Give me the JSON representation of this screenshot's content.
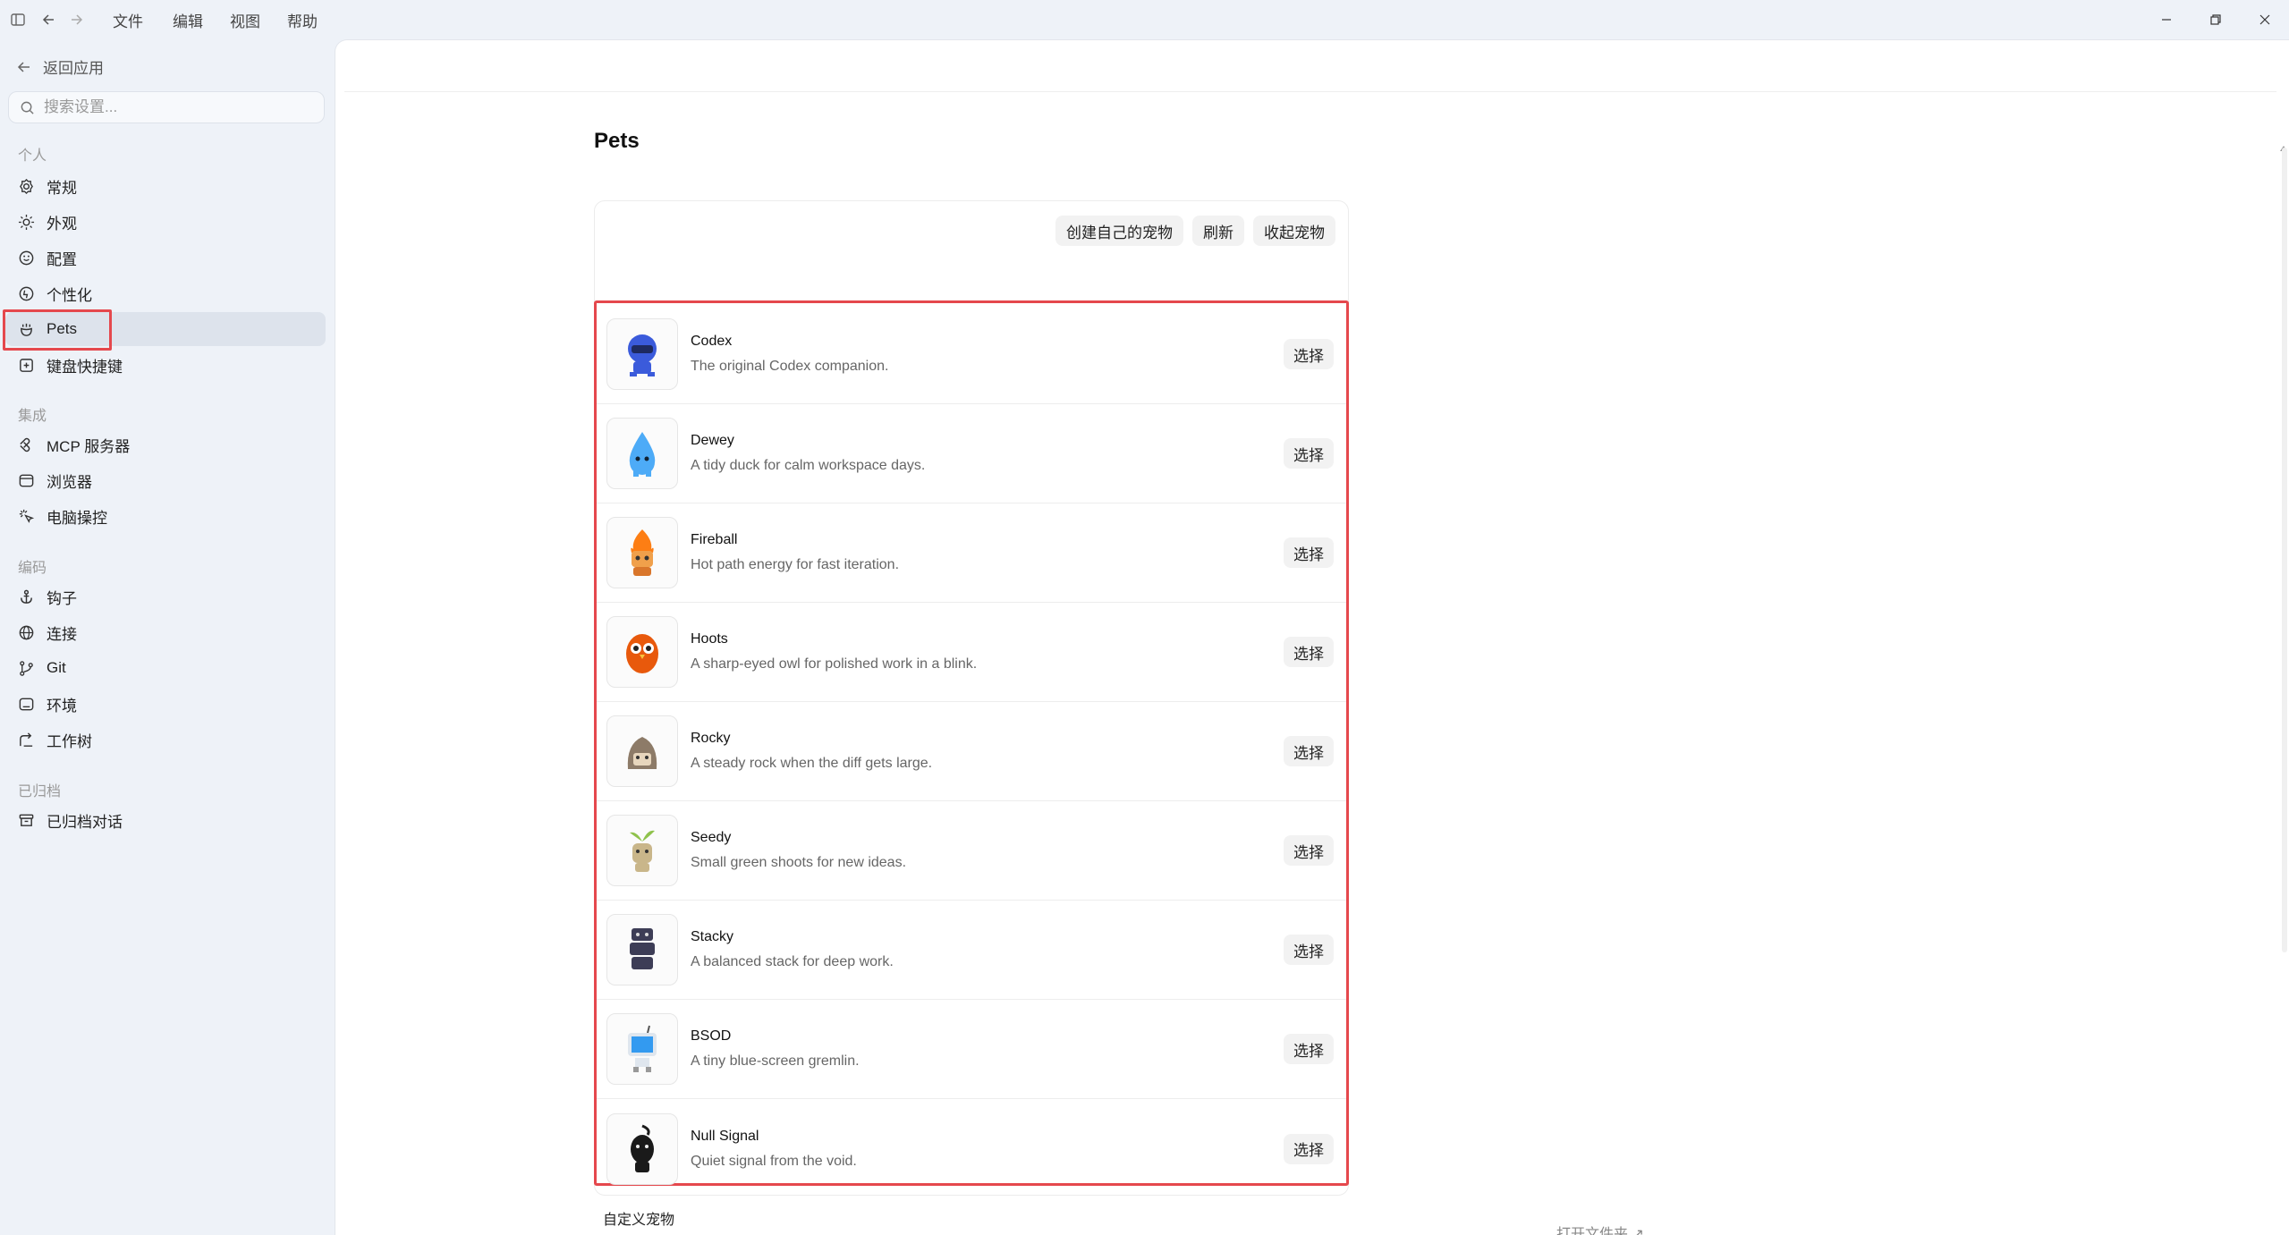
{
  "menu": [
    "文件",
    "编辑",
    "视图",
    "帮助"
  ],
  "sidebar": {
    "back_label": "返回应用",
    "search_placeholder": "搜索设置...",
    "sections": {
      "personal": "个人",
      "integration": "集成",
      "coding": "编码",
      "archived": "已归档"
    },
    "items": {
      "general": "常规",
      "appearance": "外观",
      "config": "配置",
      "personalize": "个性化",
      "pets": "Pets",
      "shortcuts": "键盘快捷键",
      "mcp": "MCP 服务器",
      "browser": "浏览器",
      "computer": "电脑操控",
      "hooks": "钩子",
      "connections": "连接",
      "git": "Git",
      "env": "环境",
      "worktree": "工作树",
      "archived_chats": "已归档对话"
    }
  },
  "main": {
    "title": "Pets",
    "toolbar": {
      "create": "创建自己的宠物",
      "refresh": "刷新",
      "collapse": "收起宠物"
    },
    "select_label": "选择",
    "pets": [
      {
        "name": "Codex",
        "desc": "The original Codex companion.",
        "color": "#3b5bdb"
      },
      {
        "name": "Dewey",
        "desc": "A tidy duck for calm workspace days.",
        "color": "#4dabf7"
      },
      {
        "name": "Fireball",
        "desc": "Hot path energy for fast iteration.",
        "color": "#fd7e14"
      },
      {
        "name": "Hoots",
        "desc": "A sharp-eyed owl for polished work in a blink.",
        "color": "#e8590c"
      },
      {
        "name": "Rocky",
        "desc": "A steady rock when the diff gets large.",
        "color": "#8d7b68"
      },
      {
        "name": "Seedy",
        "desc": "Small green shoots for new ideas.",
        "color": "#c9b68a"
      },
      {
        "name": "Stacky",
        "desc": "A balanced stack for deep work.",
        "color": "#3d3d56"
      },
      {
        "name": "BSOD",
        "desc": "A tiny blue-screen gremlin.",
        "color": "#339af0"
      },
      {
        "name": "Null Signal",
        "desc": "Quiet signal from the void.",
        "color": "#1a1a1a"
      }
    ],
    "custom_label": "自定义宠物",
    "open_folder": "打开文件夹 ↗"
  },
  "colors": {
    "highlight": "#e5484d",
    "active_bg": "#dde3ec"
  }
}
